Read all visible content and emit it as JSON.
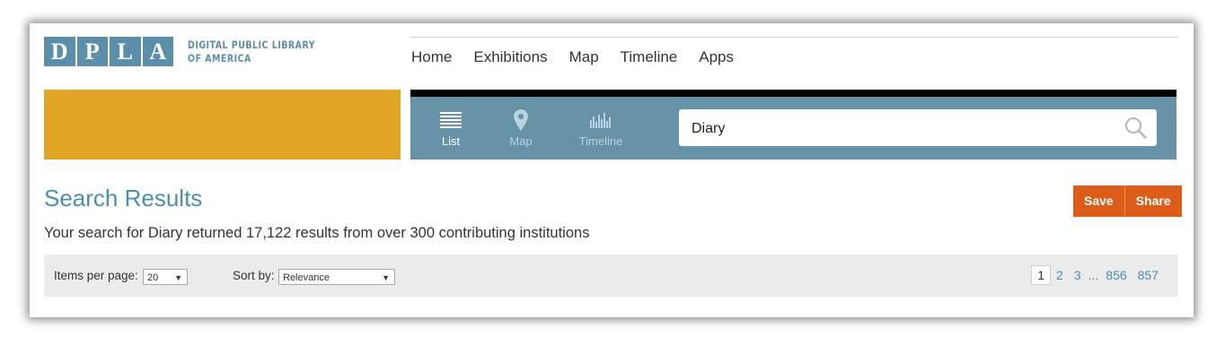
{
  "logo": {
    "letters": [
      "D",
      "P",
      "L",
      "A"
    ],
    "text": "DIGITAL PUBLIC LIBRARY\nOF AMERICA"
  },
  "nav": {
    "items": [
      "Home",
      "Exhibitions",
      "Map",
      "Timeline",
      "Apps"
    ]
  },
  "views": {
    "list": "List",
    "map": "Map",
    "timeline": "Timeline"
  },
  "search": {
    "value": "Diary"
  },
  "results": {
    "title": "Search Results",
    "summary": "Your search for Diary returned 17,122 results from over 300 contributing institutions",
    "save_label": "Save",
    "share_label": "Share"
  },
  "controls": {
    "items_per_page_label": "Items per page:",
    "items_per_page_value": "20",
    "sort_label": "Sort by:",
    "sort_value": "Relevance"
  },
  "pagination": {
    "current": "1",
    "pages": [
      "2",
      "3"
    ],
    "ellipsis": "...",
    "tail": [
      "856",
      "857"
    ]
  },
  "colors": {
    "brand_blue": "#5b8ea8",
    "orange_block": "#e2a627",
    "panel_blue": "#6592a6",
    "button_orange": "#dd5c1a",
    "title_blue": "#4a8fb2"
  },
  "icons": {
    "list": "list-icon",
    "map": "map-pin-icon",
    "timeline": "timeline-icon",
    "search": "search-icon"
  }
}
